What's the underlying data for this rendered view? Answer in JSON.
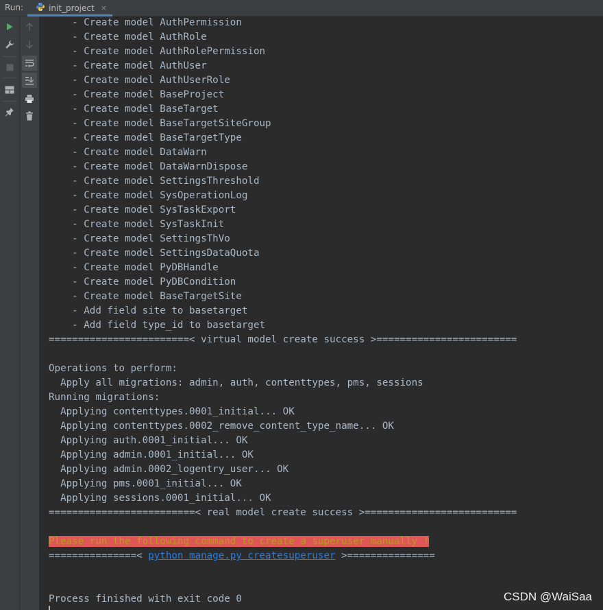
{
  "header": {
    "run_label": "Run:",
    "tab_label": "init_project",
    "tab_close": "×"
  },
  "console": {
    "lines": [
      "    - Create model AuthPermission",
      "    - Create model AuthRole",
      "    - Create model AuthRolePermission",
      "    - Create model AuthUser",
      "    - Create model AuthUserRole",
      "    - Create model BaseProject",
      "    - Create model BaseTarget",
      "    - Create model BaseTargetSiteGroup",
      "    - Create model BaseTargetType",
      "    - Create model DataWarn",
      "    - Create model DataWarnDispose",
      "    - Create model SettingsThreshold",
      "    - Create model SysOperationLog",
      "    - Create model SysTaskExport",
      "    - Create model SysTaskInit",
      "    - Create model SettingsThVo",
      "    - Create model SettingsDataQuota",
      "    - Create model PyDBHandle",
      "    - Create model PyDBCondition",
      "    - Create model BaseTargetSite",
      "    - Add field site to basetarget",
      "    - Add field type_id to basetarget",
      "========================< virtual model create success >========================",
      "",
      "Operations to perform:",
      "  Apply all migrations: admin, auth, contenttypes, pms, sessions",
      "Running migrations:",
      "  Applying contenttypes.0001_initial... OK",
      "  Applying contenttypes.0002_remove_content_type_name... OK",
      "  Applying auth.0001_initial... OK",
      "  Applying admin.0001_initial... OK",
      "  Applying admin.0002_logentry_user... OK",
      "  Applying pms.0001_initial... OK",
      "  Applying sessions.0001_initial... OK",
      "=========================< real model create success >=========================="
    ],
    "warning": "Please run the following command to create a superuser manually !",
    "command_prefix": "===============< ",
    "command_link": "python manage.py createsuperuser",
    "command_suffix": " >===============",
    "exit_message": "Process finished with exit code 0"
  },
  "watermark": "CSDN @WaiSaa",
  "icons": {
    "gutter1": [
      "run-icon",
      "wrench-icon",
      "stop-icon",
      "layout-icon",
      "pin-icon"
    ],
    "gutter2": [
      "arrow-up-icon",
      "arrow-down-icon",
      "soft-wrap-icon",
      "scroll-to-end-icon",
      "print-icon",
      "trash-icon"
    ]
  },
  "colors": {
    "console_bg": "#2b2b2b",
    "console_text": "#a9b7c6",
    "warning_bg": "#e05656",
    "warning_text": "#b99b1f",
    "link": "#287bde",
    "run_green": "#59a869"
  }
}
